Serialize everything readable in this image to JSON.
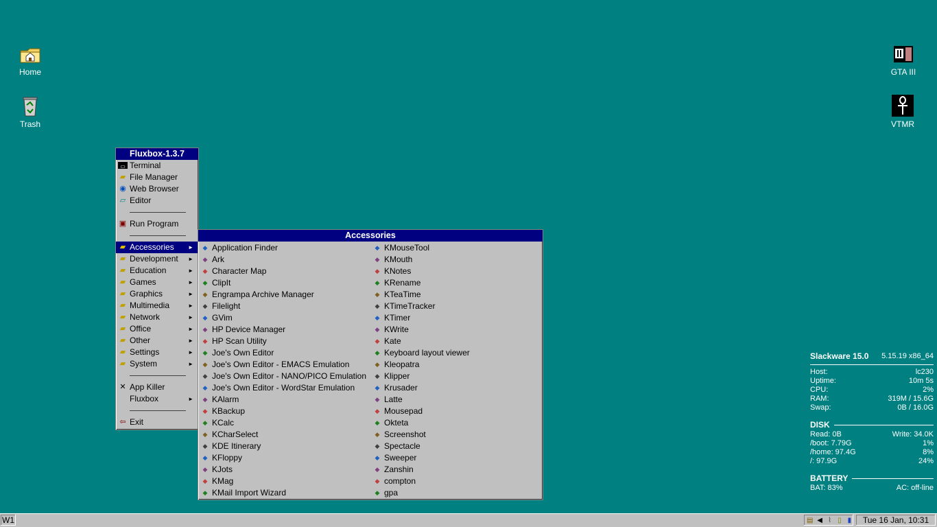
{
  "desktop": {
    "icons": [
      {
        "label": "Home",
        "icon": "folder-home-icon"
      },
      {
        "label": "Trash",
        "icon": "recycle-bin-icon"
      },
      {
        "label": "GTA III",
        "icon": "gta-icon"
      },
      {
        "label": "VTMR",
        "icon": "ankh-icon"
      }
    ]
  },
  "root_menu": {
    "title": "Fluxbox-1.3.7",
    "items": [
      {
        "label": "Terminal",
        "icon": "terminal-icon"
      },
      {
        "label": "File Manager",
        "icon": "folder-icon"
      },
      {
        "label": "Web Browser",
        "icon": "globe-icon"
      },
      {
        "label": "Editor",
        "icon": "editor-icon"
      },
      {
        "label": "Run Program",
        "icon": "run-icon"
      },
      {
        "label": "Accessories",
        "icon": "folder-icon",
        "submenu": true,
        "active": true
      },
      {
        "label": "Development",
        "icon": "folder-icon",
        "submenu": true
      },
      {
        "label": "Education",
        "icon": "folder-icon",
        "submenu": true
      },
      {
        "label": "Games",
        "icon": "folder-icon",
        "submenu": true
      },
      {
        "label": "Graphics",
        "icon": "folder-icon",
        "submenu": true
      },
      {
        "label": "Multimedia",
        "icon": "folder-icon",
        "submenu": true
      },
      {
        "label": "Network",
        "icon": "folder-icon",
        "submenu": true
      },
      {
        "label": "Office",
        "icon": "folder-icon",
        "submenu": true
      },
      {
        "label": "Other",
        "icon": "folder-icon",
        "submenu": true
      },
      {
        "label": "Settings",
        "icon": "folder-icon",
        "submenu": true
      },
      {
        "label": "System",
        "icon": "folder-icon",
        "submenu": true
      },
      {
        "label": "App Killer",
        "icon": "kill-icon"
      },
      {
        "label": "Fluxbox",
        "icon": "",
        "submenu": true
      },
      {
        "label": "Exit",
        "icon": "exit-icon"
      }
    ],
    "submenu_arrow": "►"
  },
  "accessories_menu": {
    "title": "Accessories",
    "left": [
      "Application Finder",
      "Ark",
      "Character Map",
      "ClipIt",
      "Engrampa Archive Manager",
      "Filelight",
      "GVim",
      "HP Device Manager",
      "HP Scan Utility",
      "Joe's Own Editor",
      "Joe's Own Editor - EMACS Emulation",
      "Joe's Own Editor - NANO/PICO Emulation",
      "Joe's Own Editor - WordStar Emulation",
      "KAlarm",
      "KBackup",
      "KCalc",
      "KCharSelect",
      "KDE Itinerary",
      "KFloppy",
      "KJots",
      "KMag",
      "KMail Import Wizard"
    ],
    "right": [
      "KMouseTool",
      "KMouth",
      "KNotes",
      "KRename",
      "KTeaTime",
      "KTimeTracker",
      "KTimer",
      "KWrite",
      "Kate",
      "Keyboard layout viewer",
      "Kleopatra",
      "Klipper",
      "Krusader",
      "Latte",
      "Mousepad",
      "Okteta",
      "Screenshot",
      "Spectacle",
      "Sweeper",
      "Zanshin",
      "compton",
      "gpa"
    ]
  },
  "conky": {
    "title": "Slackware 15.0",
    "kernel": "5.15.19 x86_64",
    "sys": [
      {
        "k": "Host:",
        "v": "lc230"
      },
      {
        "k": "Uptime:",
        "v": "10m 5s"
      },
      {
        "k": "CPU:",
        "v": "2%"
      },
      {
        "k": "RAM:",
        "v": "319M / 15.6G"
      },
      {
        "k": "Swap:",
        "v": "0B / 16.0G"
      }
    ],
    "disk_header": "DISK",
    "disk": [
      {
        "k": "Read: 0B",
        "v": "Write: 34.0K"
      },
      {
        "k": "/boot: 7.79G",
        "v": "1%"
      },
      {
        "k": "/home: 97.4G",
        "v": "8%"
      },
      {
        "k": "/: 97.9G",
        "v": "24%"
      }
    ],
    "battery_header": "BATTERY",
    "battery": {
      "k": "BAT: 83%",
      "v": "AC: off-line"
    }
  },
  "taskbar": {
    "workspace": "W1",
    "clock": "Tue 16 Jan, 10:31",
    "tray": [
      "clipboard-icon",
      "volume-icon",
      "network-icon",
      "phone-icon",
      "battery-icon"
    ]
  },
  "colors": {
    "desktop": "#008080",
    "menu_bg": "#c0c0c0",
    "menu_title": "#000080",
    "highlight": "#000080"
  }
}
